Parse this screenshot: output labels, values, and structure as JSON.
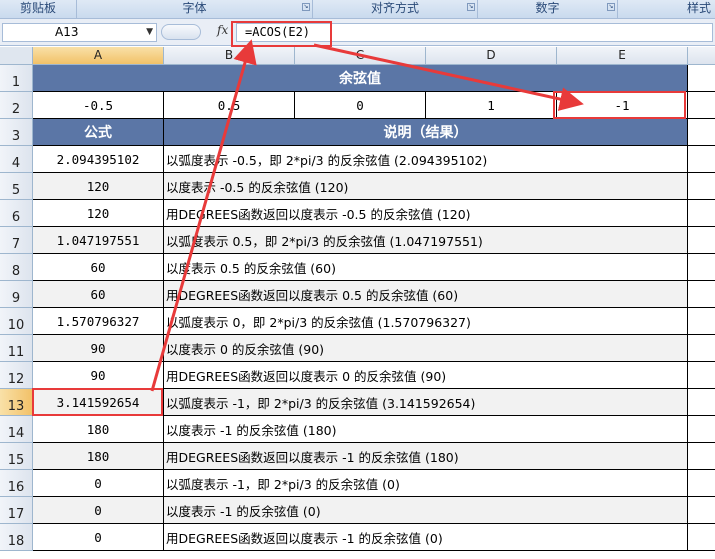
{
  "ribbon": {
    "groups": [
      "剪贴板",
      "字体",
      "对齐方式",
      "数字",
      "样式"
    ]
  },
  "formula_bar": {
    "name_box": "A13",
    "fx_label": "fx",
    "formula": "=ACOS(E2)"
  },
  "columns": [
    "A",
    "B",
    "C",
    "D",
    "E"
  ],
  "rows": [
    "1",
    "2",
    "3",
    "4",
    "5",
    "6",
    "7",
    "8",
    "9",
    "10",
    "11",
    "12",
    "13",
    "14",
    "15",
    "16",
    "17",
    "18"
  ],
  "sheet": {
    "title": "余弦值",
    "inputs": [
      "-0.5",
      "0.5",
      "0",
      "1",
      "-1"
    ],
    "header_formula": "公式",
    "header_desc": "说明（结果）",
    "data": [
      {
        "value": "2.094395102",
        "desc": "以弧度表示 -0.5，即 2*pi/3 的反余弦值 (2.094395102)"
      },
      {
        "value": "120",
        "desc": "以度表示 -0.5 的反余弦值 (120)"
      },
      {
        "value": "120",
        "desc": "用DEGREES函数返回以度表示 -0.5 的反余弦值 (120)"
      },
      {
        "value": "1.047197551",
        "desc": "以弧度表示 0.5，即 2*pi/3 的反余弦值 (1.047197551)"
      },
      {
        "value": "60",
        "desc": "以度表示 0.5 的反余弦值 (60)"
      },
      {
        "value": "60",
        "desc": "用DEGREES函数返回以度表示 0.5 的反余弦值 (60)"
      },
      {
        "value": "1.570796327",
        "desc": "以弧度表示 0，即 2*pi/3 的反余弦值 (1.570796327)"
      },
      {
        "value": "90",
        "desc": "以度表示 0 的反余弦值 (90)"
      },
      {
        "value": "90",
        "desc": "用DEGREES函数返回以度表示 0 的反余弦值 (90)"
      },
      {
        "value": "3.141592654",
        "desc": "以弧度表示 -1，即 2*pi/3 的反余弦值 (3.141592654)"
      },
      {
        "value": "180",
        "desc": "以度表示 -1 的反余弦值 (180)"
      },
      {
        "value": "180",
        "desc": "用DEGREES函数返回以度表示 -1 的反余弦值 (180)"
      },
      {
        "value": "0",
        "desc": "以弧度表示 -1，即 2*pi/3 的反余弦值 (0)"
      },
      {
        "value": "0",
        "desc": "以度表示 -1 的反余弦值 (0)"
      },
      {
        "value": "0",
        "desc": "用DEGREES函数返回以度表示 -1 的反余弦值 (0)"
      }
    ]
  },
  "colors": {
    "header_fill": "#5b76a6",
    "annotation": "#e83a3a",
    "selected_header": "#f2c168"
  }
}
